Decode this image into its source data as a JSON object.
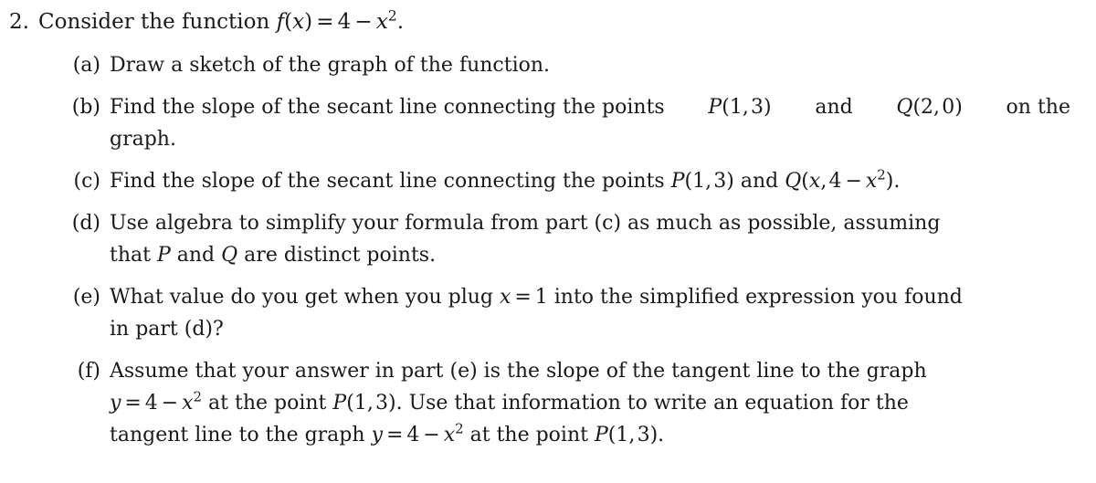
{
  "document": {
    "type": "math-exercise",
    "text_color": "#1a1a1a",
    "background_color": "#ffffff"
  },
  "problem": {
    "number": "2.",
    "stem_prefix": "Consider the function ",
    "stem_math": "f(x) = 4 − x²",
    "stem_suffix": ".",
    "stem_full": "Consider the function f(x) = 4 − x²."
  },
  "subparts": [
    {
      "label": "(a)",
      "text": "Draw a sketch of the graph of the function.",
      "lines": [
        "Draw a sketch of the graph of the function."
      ]
    },
    {
      "label": "(b)",
      "text": "Find the slope of the secant line connecting the points P(1, 3) and Q(2, 0) on the graph.",
      "line1_a": "Find the slope of the secant line connecting the points ",
      "line1_math1": "P(1, 3)",
      "line1_b": " and ",
      "line1_math2": "Q(2, 0)",
      "line1_c": " on the",
      "line2": "graph."
    },
    {
      "label": "(c)",
      "text": "Find the slope of the secant line connecting the points P(1, 3) and Q(x, 4 − x²).",
      "line1_a": "Find the slope of the secant line connecting the points ",
      "line1_math1": "P(1, 3)",
      "line1_b": " and ",
      "line1_math2": "Q(x, 4 − x²)",
      "line1_c": "."
    },
    {
      "label": "(d)",
      "text": "Use algebra to simplify your formula from part (c) as much as possible, assuming that P and Q are distinct points.",
      "line1": "Use algebra to simplify your formula from part (c) as much as possible, assuming",
      "line2_a": "that ",
      "line2_math1": "P",
      "line2_b": " and ",
      "line2_math2": "Q",
      "line2_c": " are distinct points."
    },
    {
      "label": "(e)",
      "text": "What value do you get when you plug x = 1 into the simplified expression you found in part (d)?",
      "line1_a": "What value do you get when you plug ",
      "line1_math1": "x = 1",
      "line1_b": " into the simplified expression you found",
      "line2": "in part (d)?"
    },
    {
      "label": "(f)",
      "text": "Assume that your answer in part (e) is the slope of the tangent line to the graph y = 4 − x² at the point P(1, 3). Use that information to write an equation for the tangent line to the graph y = 4 − x² at the point P(1, 3).",
      "line1": "Assume that your answer in part (e) is the slope of the tangent line to the graph",
      "line2_math1": "y = 4 − x²",
      "line2_a": " at the point ",
      "line2_math2": "P(1, 3)",
      "line2_b": ". Use that information to write an equation for the",
      "line3_a": "tangent line to the graph ",
      "line3_math1": "y = 4 − x²",
      "line3_b": " at the point ",
      "line3_math2": "P(1, 3)",
      "line3_c": "."
    }
  ]
}
